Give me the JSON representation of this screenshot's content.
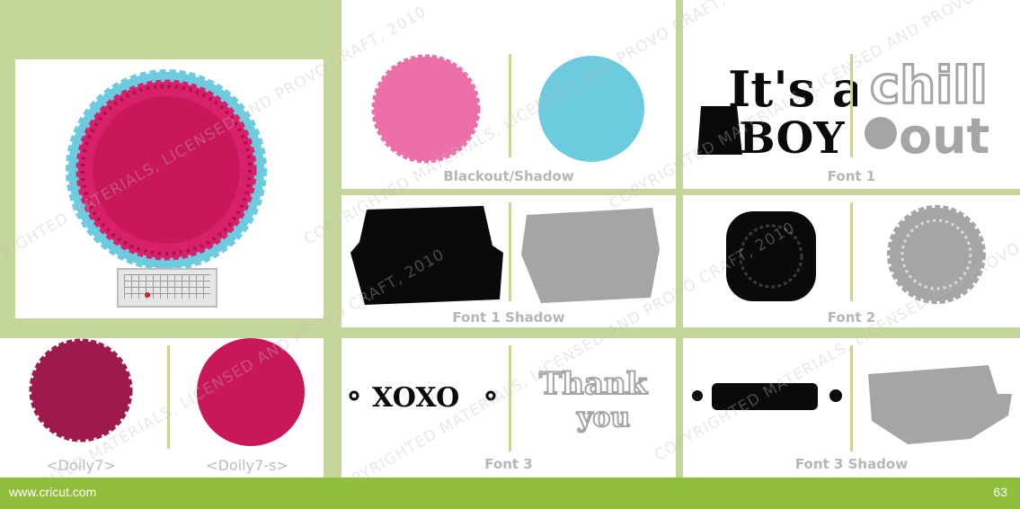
{
  "panels": {
    "blackout_shadow": {
      "caption": "Blackout/Shadow"
    },
    "font1": {
      "caption": "Font 1"
    },
    "font1_shadow": {
      "caption": "Font 1 Shadow"
    },
    "font2": {
      "caption": "Font 2"
    },
    "doily": {
      "caption_left": "<Doily7>",
      "caption_right": "<Doily7-s>"
    },
    "font3": {
      "caption": "Font 3"
    },
    "font3_shadow": {
      "caption": "Font 3 Shadow"
    }
  },
  "artwork_text": {
    "its_a": "It's a",
    "boy": "BOY",
    "chill": "chill",
    "out": "out",
    "xoxo": "XOXO",
    "thank": "Thank",
    "you": "you"
  },
  "watermark_text": "COPYRIGHTED MATERIALS, LICENSED AND PROVO CRAFT, 2010",
  "footer": {
    "url": "www.cricut.com",
    "page_number": "63"
  },
  "colors": {
    "page_green": "#c4d69a",
    "footer_green": "#8fbe3d",
    "pink": "#ec6fa7",
    "cyan": "#6ccbdf",
    "magenta": "#c9185a",
    "burgundy": "#9e1a4a",
    "gray": "#a5a5a5",
    "black": "#0a0a0a"
  }
}
